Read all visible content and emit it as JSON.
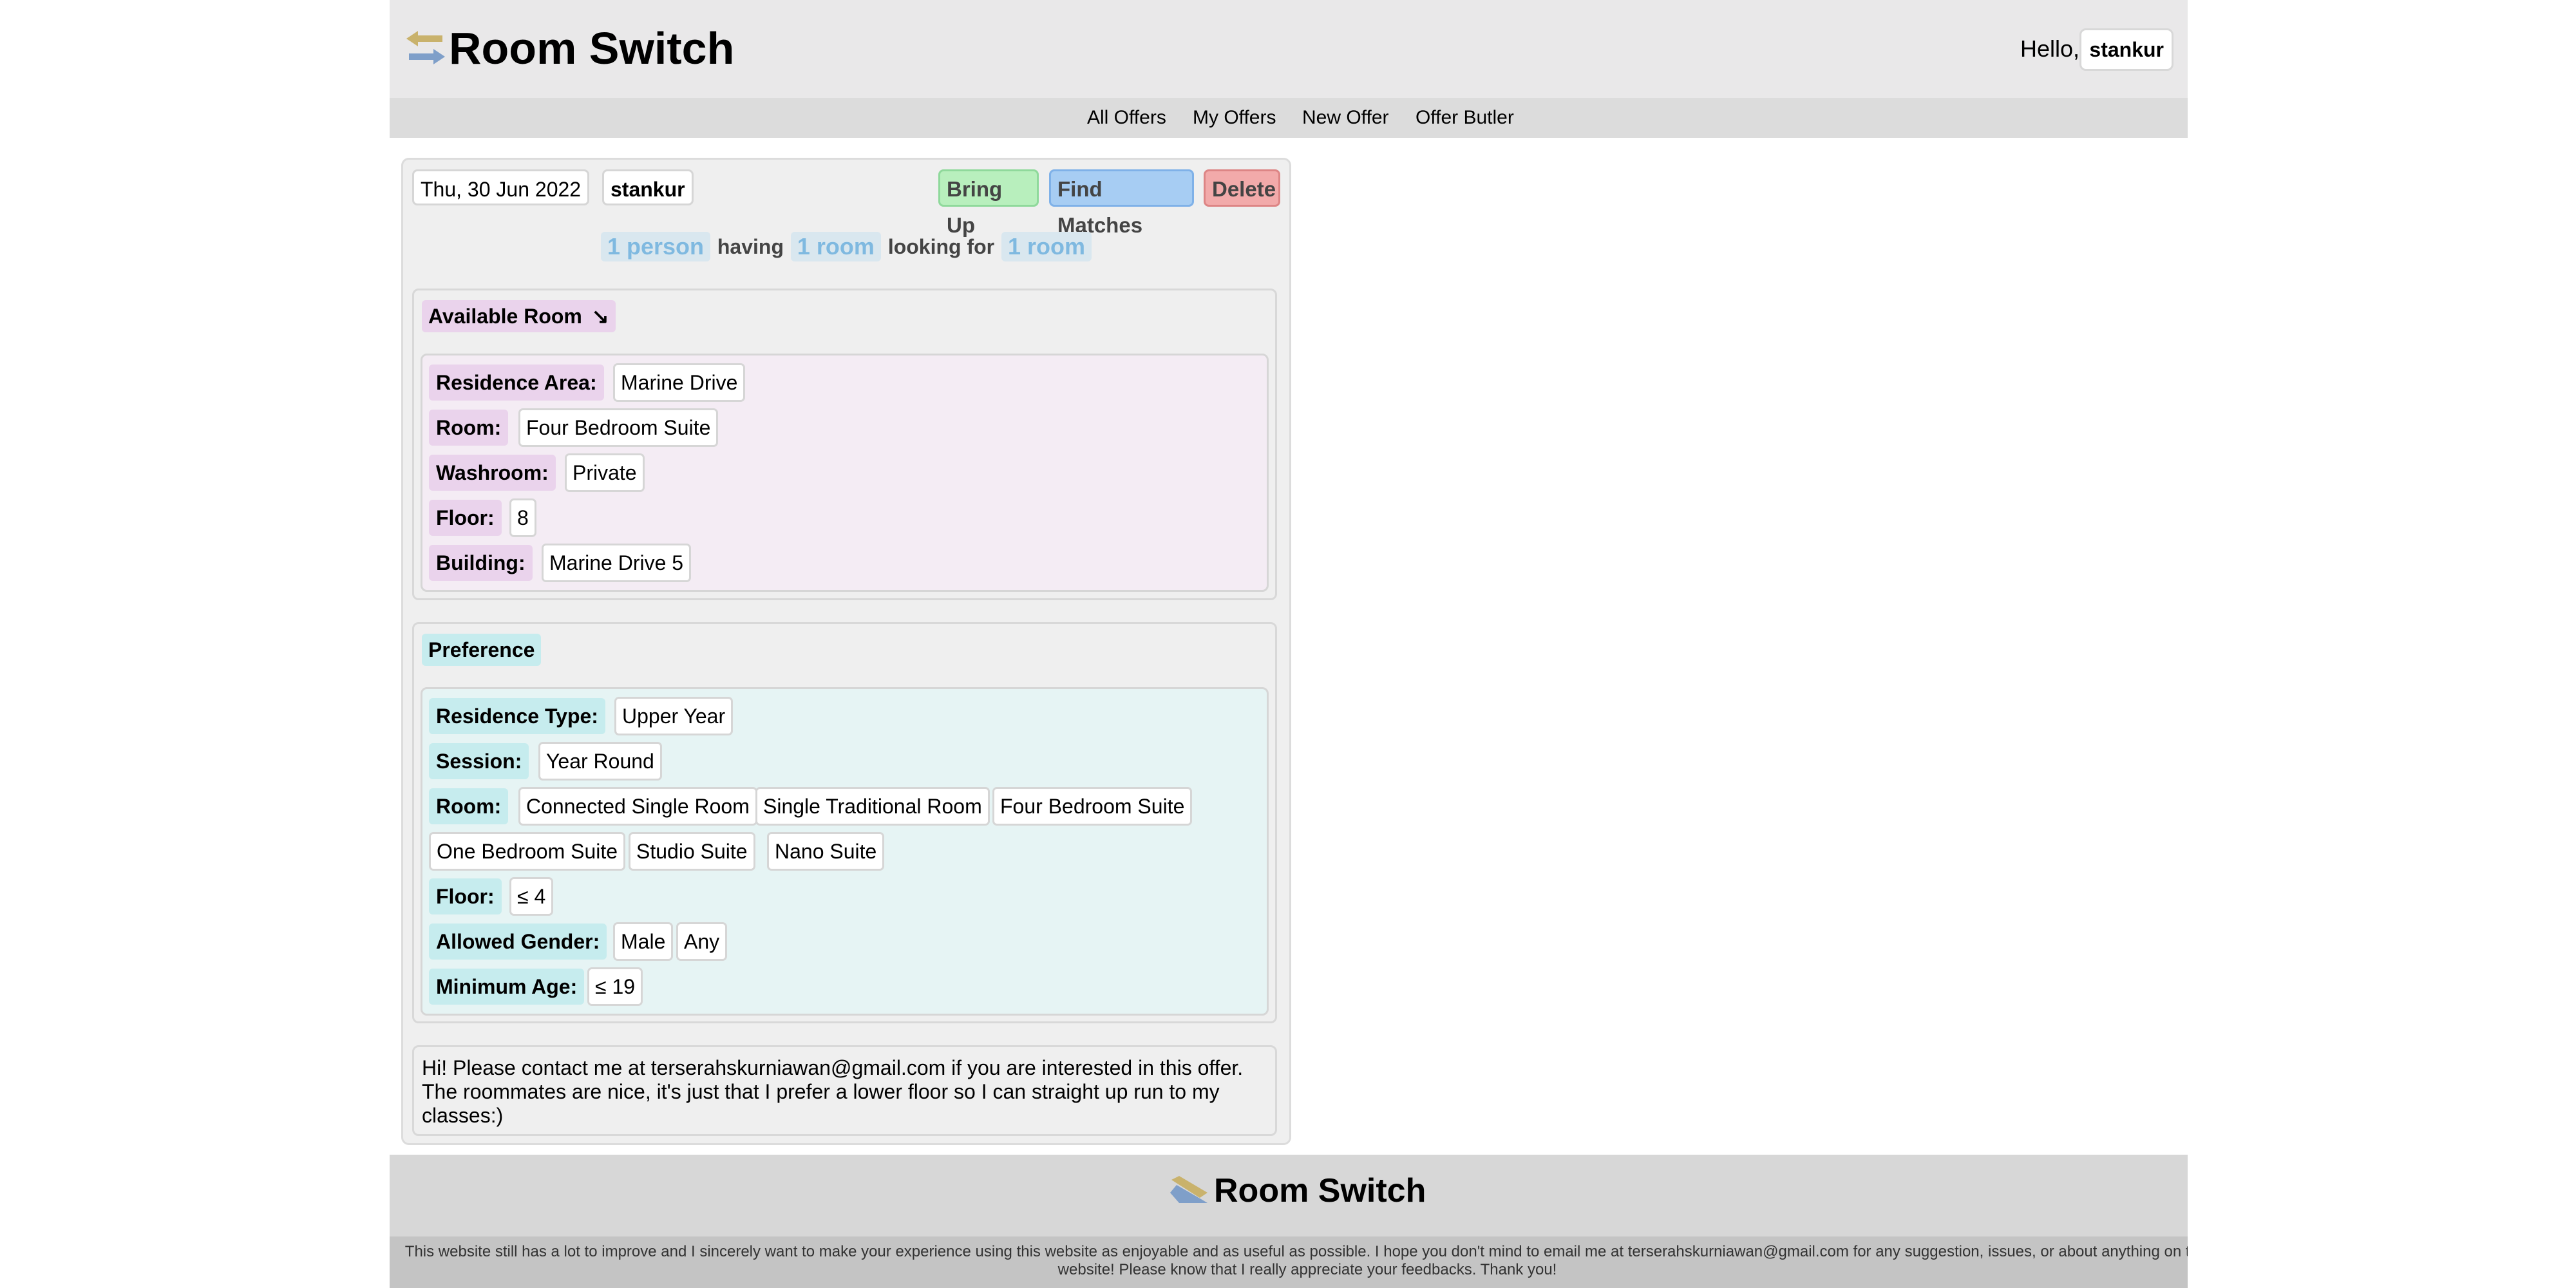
{
  "header": {
    "brand": "Room Switch",
    "greeting": "Hello,",
    "username": "stankur",
    "logo_icon": "swap-arrows-icon"
  },
  "nav": {
    "items": [
      "All Offers",
      "My Offers",
      "New Offer",
      "Offer Butler"
    ]
  },
  "offer": {
    "date": "Thu, 30 Jun 2022",
    "owner": "stankur",
    "actions": {
      "bring_up": "Bring Up",
      "find_matches": "Find Matches",
      "delete": "Delete"
    },
    "summary": {
      "people": "1 person",
      "having_word": "having",
      "rooms_have": "1 room",
      "looking_word": "looking for",
      "rooms_want": "1 room"
    },
    "available": {
      "title": "Available Room",
      "title_icon": "↘",
      "fields": [
        {
          "label": "Residence Area:",
          "values": [
            "Marine Drive"
          ]
        },
        {
          "label": "Room:",
          "values": [
            "Four Bedroom Suite"
          ]
        },
        {
          "label": "Washroom:",
          "values": [
            "Private"
          ]
        },
        {
          "label": "Floor:",
          "values": [
            "8"
          ]
        },
        {
          "label": "Building:",
          "values": [
            "Marine Drive 5"
          ]
        }
      ]
    },
    "preference": {
      "title": "Preference",
      "fields": [
        {
          "label": "Residence Type:",
          "values": [
            "Upper Year"
          ]
        },
        {
          "label": "Session:",
          "values": [
            "Year Round"
          ]
        },
        {
          "label": "Room:",
          "values": [
            "Connected Single Room",
            "Single Traditional Room",
            "Four Bedroom Suite",
            "One Bedroom Suite",
            "Studio Suite",
            "Nano Suite"
          ]
        },
        {
          "label": "Floor:",
          "values": [
            "≤ 4"
          ]
        },
        {
          "label": "Allowed Gender:",
          "values": [
            "Male",
            "Any"
          ]
        },
        {
          "label": "Minimum Age:",
          "values": [
            "≤ 19"
          ]
        }
      ]
    },
    "message": "Hi! Please contact me at terserahskurniawan@gmail.com if you are interested in this offer. The roommates are nice, it's just that I prefer a lower floor so I can straight up run to my classes:)"
  },
  "footer": {
    "brand": "Room Switch",
    "note": "This website still has a lot to improve and I sincerely want to make your experience using this website as enjoyable and as useful as possible. I hope you don't mind to email me at terserahskurniawan@gmail.com for any suggestion, issues, or about anything on this website! Please know that I really appreciate your feedbacks. Thank you!"
  },
  "colors": {
    "header_bg": "#e9e8e9",
    "nav_bg": "#dcdcdc",
    "available_accent": "#ead3ec",
    "preference_accent": "#c6ecee",
    "bring_up": "#b8efbd",
    "find_matches": "#a7cdf3",
    "delete": "#f2aaaa",
    "summary_pill_text": "#7fb9e0"
  }
}
